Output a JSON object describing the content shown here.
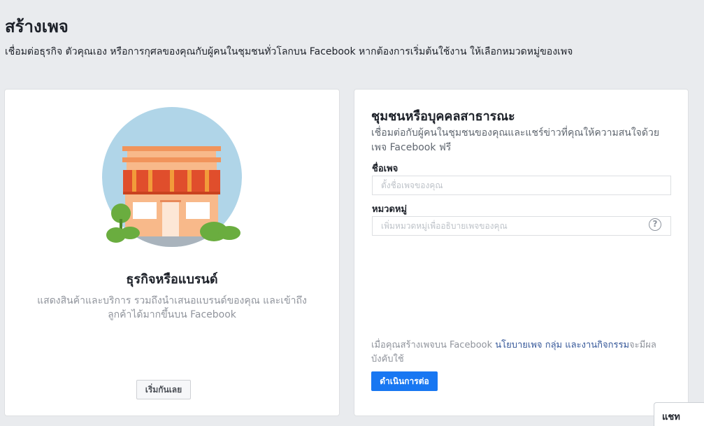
{
  "header": {
    "title": "สร้างเพจ",
    "subtitle": "เชื่อมต่อธุรกิจ ตัวคุณเอง หรือการกุศลของคุณกับผู้คนในชุมชนทั่วโลกบน Facebook หากต้องการเริ่มต้นใช้งาน ให้เลือกหมวดหมู่ของเพจ"
  },
  "business_card": {
    "title": "ธุรกิจหรือแบรนด์",
    "description": "แสดงสินค้าและบริการ รวมถึงนำเสนอแบรนด์ของคุณ และเข้าถึงลูกค้าได้มากขึ้นบน Facebook",
    "button_label": "เริ่มกันเลย",
    "illustration_icon": "storefront-icon"
  },
  "community_card": {
    "title": "ชุมชนหรือบุคคลสาธารณะ",
    "description": "เชื่อมต่อกับผู้คนในชุมชนของคุณและแชร์ข่าวที่คุณให้ความสนใจด้วยเพจ Facebook ฟรี",
    "page_name_label": "ชื่อเพจ",
    "page_name_value": "",
    "page_name_placeholder": "ตั้งชื่อเพจของคุณ",
    "category_label": "หมวดหมู่",
    "category_value": "",
    "category_placeholder": "เพิ่มหมวดหมู่เพื่ออธิบายเพจของคุณ",
    "help_icon": "question-circle-icon",
    "help_glyph": "?",
    "terms_prefix": "เมื่อคุณสร้างเพจบน Facebook ",
    "terms_link_pages": "นโยบายเพจ",
    "terms_link_groups": "กลุ่ม",
    "terms_link_events": "และงานกิจกรรม",
    "terms_suffix": "จะมีผลบังคับใช้",
    "continue_label": "ดำเนินการต่อ"
  },
  "chat": {
    "label": "แชท"
  },
  "colors": {
    "background": "#e9ebee",
    "primary_button": "#1877f2",
    "link": "#365899",
    "illustration_circle": "#b0d5e8",
    "awning_red": "#e04e2c",
    "roof_orange": "#f1945b",
    "wall_peach": "#f8b98a",
    "bush_green": "#6aad3f"
  }
}
